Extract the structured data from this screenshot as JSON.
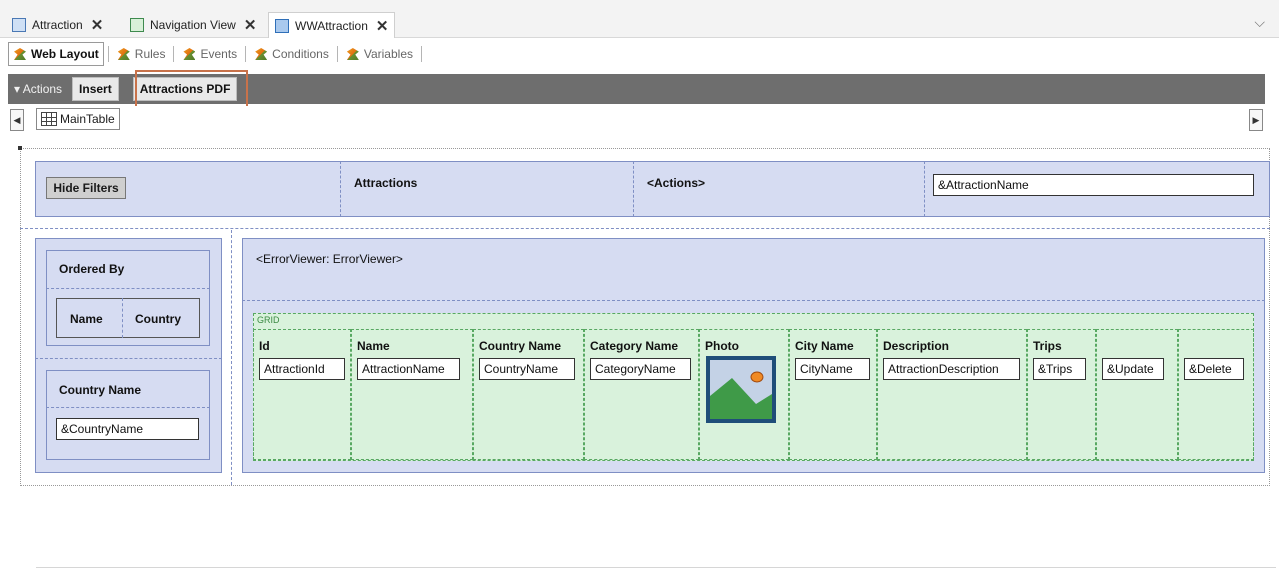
{
  "tabs": [
    {
      "label": "Attraction"
    },
    {
      "label": "Navigation View"
    },
    {
      "label": "WWAttraction"
    }
  ],
  "section_tabs": [
    "Web Layout",
    "Rules",
    "Events",
    "Conditions",
    "Variables"
  ],
  "actions": {
    "toggle_label": "▾ Actions",
    "buttons": [
      "Insert",
      "Attractions PDF"
    ]
  },
  "breadcrumb": {
    "label": "MainTable"
  },
  "header": {
    "hide_filters": "Hide Filters",
    "title": "Attractions",
    "actions_placeholder": "<Actions>",
    "search_field": "&AttractionName"
  },
  "filters": {
    "ordered_by_label": "Ordered By",
    "order_options": [
      "Name",
      "Country"
    ],
    "country_label": "Country Name",
    "country_field": "&CountryName"
  },
  "error_viewer": "<ErrorViewer: ErrorViewer>",
  "grid": {
    "label": "GRID",
    "columns": [
      {
        "header": "Id",
        "field": "AttractionId"
      },
      {
        "header": "Name",
        "field": "AttractionName"
      },
      {
        "header": "Country Name",
        "field": "CountryName"
      },
      {
        "header": "Category Name",
        "field": "CategoryName"
      },
      {
        "header": "Photo",
        "field": ""
      },
      {
        "header": "City Name",
        "field": "CityName"
      },
      {
        "header": "Description",
        "field": "AttractionDescription"
      },
      {
        "header": "Trips",
        "field": "&Trips"
      },
      {
        "header": "",
        "field": "&Update"
      },
      {
        "header": "",
        "field": "&Delete"
      }
    ]
  },
  "colors": {
    "panel": "#d6dcf2",
    "grid": "#d9f2dc",
    "highlight": "#c8724a",
    "toolbar": "#6e6e6e"
  }
}
